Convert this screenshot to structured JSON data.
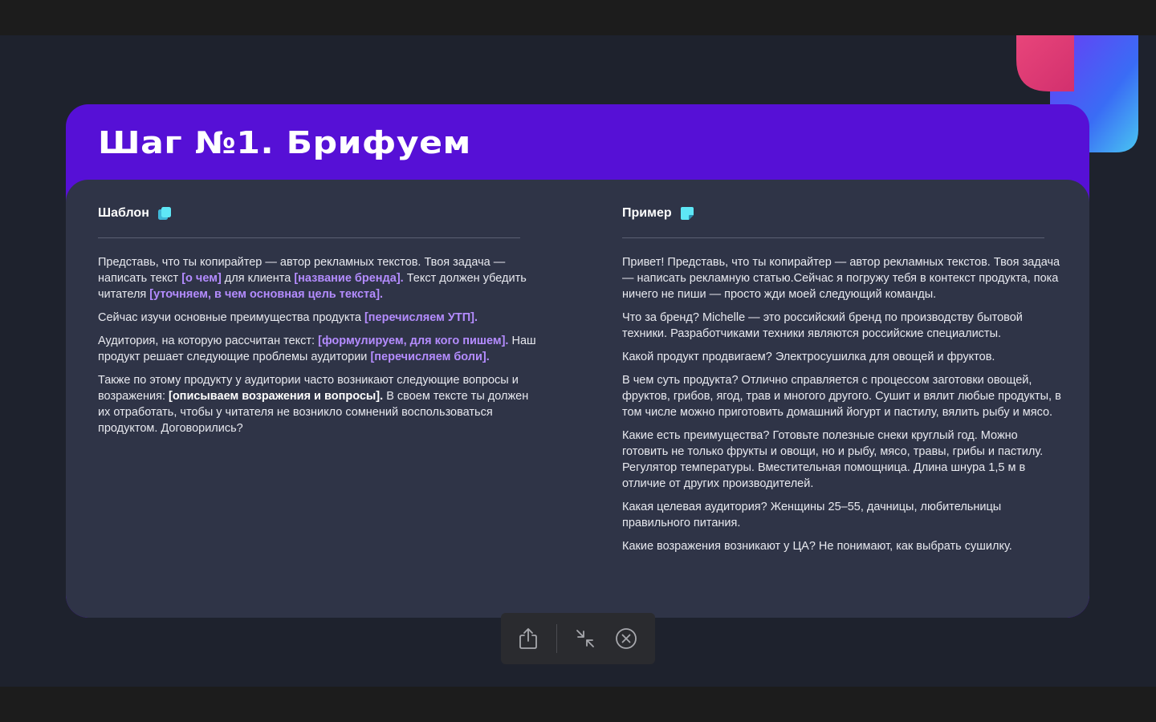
{
  "slide": {
    "title": "Шаг №1. Брифуем",
    "colors": {
      "accent": "#5610d6",
      "highlight": "#b48cff",
      "icon": "#5ee7f6"
    }
  },
  "template_col": {
    "header": "Шаблон",
    "icon": "copy-icon",
    "p1": {
      "a": "Представь, что ты копирайтер — автор рекламных текстов. Твоя задача — написать текст ",
      "h1": "[о чем]",
      "b": " для клиента ",
      "h2": "[название бренда].",
      "c": " Текст должен убедить читателя ",
      "h3": "[уточняем, в чем основная цель текста]."
    },
    "p2": {
      "a": "Сейчас изучи основные преимущества продукта ",
      "h1": "[перечисляем УТП]."
    },
    "p3": {
      "a": "Аудитория, на которую рассчитан текст: ",
      "h1": "[формулируем, для кого пишем].",
      "b": " Наш продукт решает следующие проблемы аудитории ",
      "h2": "[перечисляем боли]."
    },
    "p4": {
      "a": "Также по этому продукту у аудитории часто возникают следующие вопросы и возражения: ",
      "h1": "[описываем возражения и вопросы].",
      "b": " В своем тексте ты должен их отработать, чтобы у читателя не возникло сомнений воспользоваться продуктом. Договорились?"
    }
  },
  "example_col": {
    "header": "Пример",
    "icon": "note-icon",
    "paragraphs": [
      "Привет! Представь, что ты копирайтер — автор рекламных текстов. Твоя задача — написать рекламную статью.Сейчас я погружу тебя в контекст продукта, пока ничего не пиши — просто жди моей следующий команды.",
      "Что за бренд? Michelle — это российский бренд по производству бытовой техники. Разработчиками техники являются российские специалисты.",
      "Какой продукт продвигаем? Электросушилка для овощей и фруктов.",
      "В чем суть продукта? Отлично справляется с процессом заготовки овощей, фруктов, грибов, ягод, трав и многого другого. Сушит и вялит любые продукты, в том числе можно приготовить домашний йогурт и пастилу, вялить рыбу и мясо.",
      "Какие есть преимущества? Готовьте полезные снеки круглый год.  Можно готовить не только фрукты и овощи, но и рыбу, мясо, травы, грибы и пастилу. Регулятор температуры. Вместительная помощница. Длина шнура 1,5 м в отличие от других производителей.",
      "Какая целевая аудитория? Женщины 25–55, дачницы, любительницы правильного питания.",
      "Какие возражения возникают у ЦА? Не понимают, как выбрать сушилку."
    ]
  },
  "toolbar": {
    "share_icon": "share-icon",
    "collapse_icon": "collapse-icon",
    "close_icon": "close-circle-icon"
  }
}
